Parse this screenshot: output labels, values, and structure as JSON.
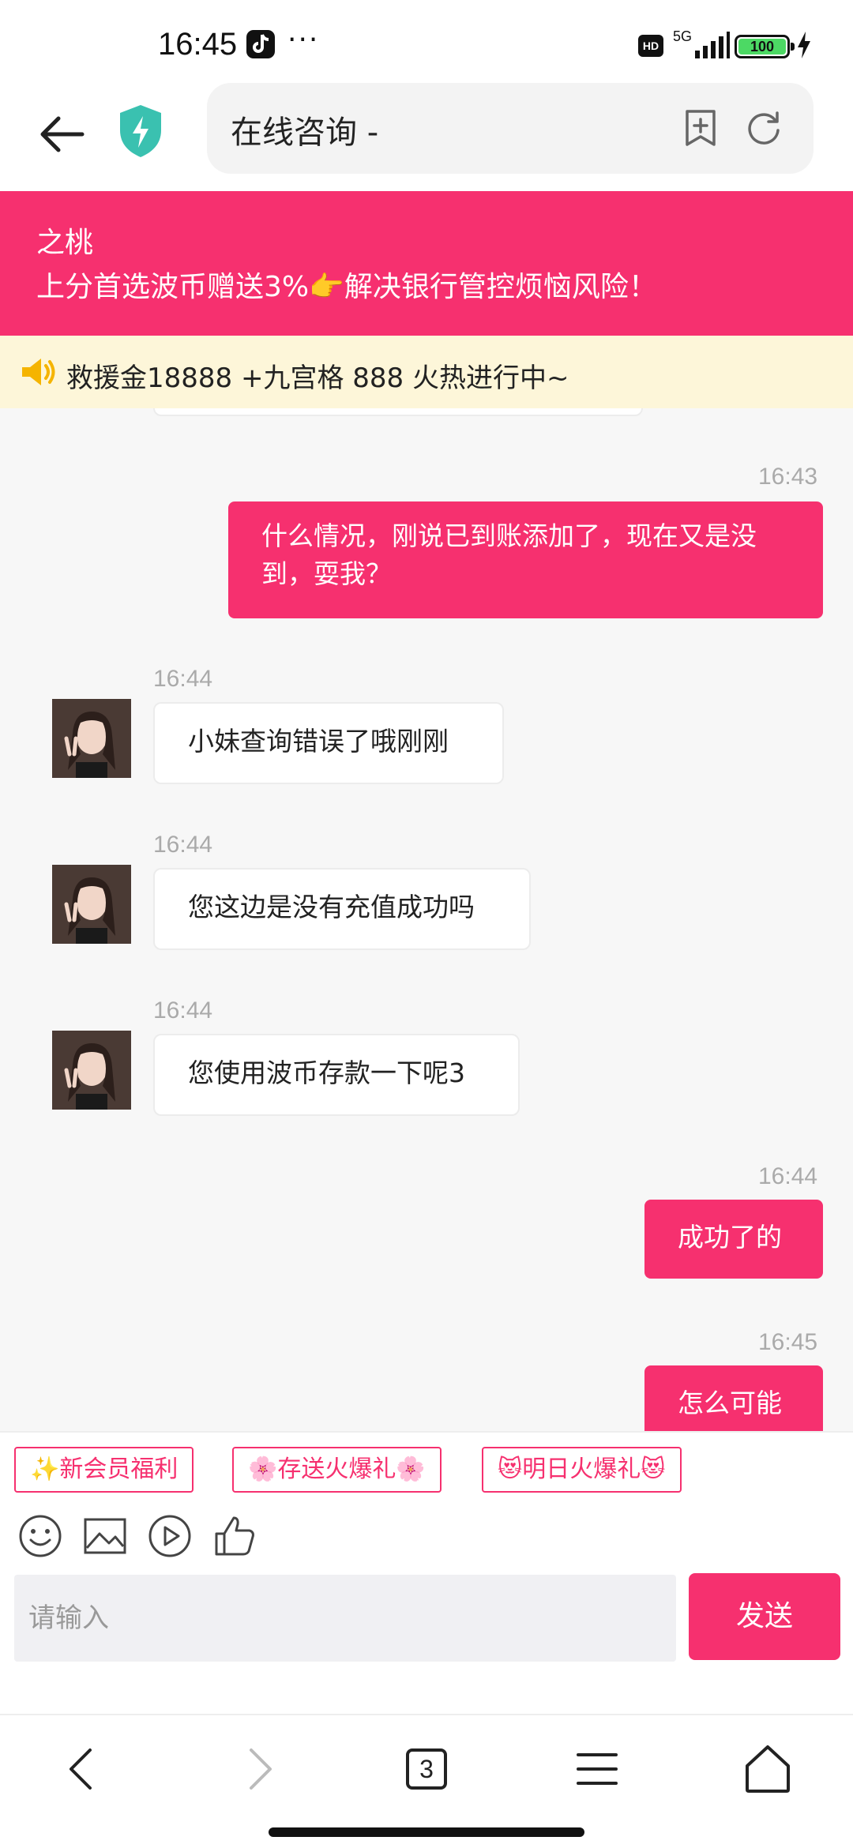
{
  "status_bar": {
    "time": "16:45",
    "more": "···",
    "hd": "HD",
    "network": "5G",
    "battery": "100"
  },
  "browser": {
    "title": "在线咨询 -"
  },
  "banner": {
    "name": "之桃",
    "promo": "上分首选波币赠送3%👉解决银行管控烦恼风险！"
  },
  "notice": {
    "text": "救援金18888 +九宫格 888 火热进行中~"
  },
  "messages": [
    {
      "side": "me",
      "time": "16:43",
      "text": "什么情况，刚说已到账添加了，现在又是没到，耍我？"
    },
    {
      "side": "them",
      "time": "16:44",
      "text": "小妹查询错误了哦刚刚"
    },
    {
      "side": "them",
      "time": "16:44",
      "text": "您这边是没有充值成功吗"
    },
    {
      "side": "them",
      "time": "16:44",
      "text": "您使用波币存款一下呢3"
    },
    {
      "side": "me",
      "time": "16:44",
      "text": "成功了的"
    },
    {
      "side": "me",
      "time": "16:45",
      "text": "怎么可能"
    }
  ],
  "quick_tags": [
    "✨新会员福利",
    "🌸存送火爆礼🌸",
    "😻明日火爆礼😻"
  ],
  "tools": [
    "smile-icon",
    "image-icon",
    "video-icon",
    "thumbs-up-icon"
  ],
  "input": {
    "placeholder": "请输入",
    "send_label": "发送"
  },
  "bottom_nav": {
    "tabs_count": "3"
  },
  "colors": {
    "accent": "#f6306f",
    "notice_bg": "#fdf6d9"
  }
}
